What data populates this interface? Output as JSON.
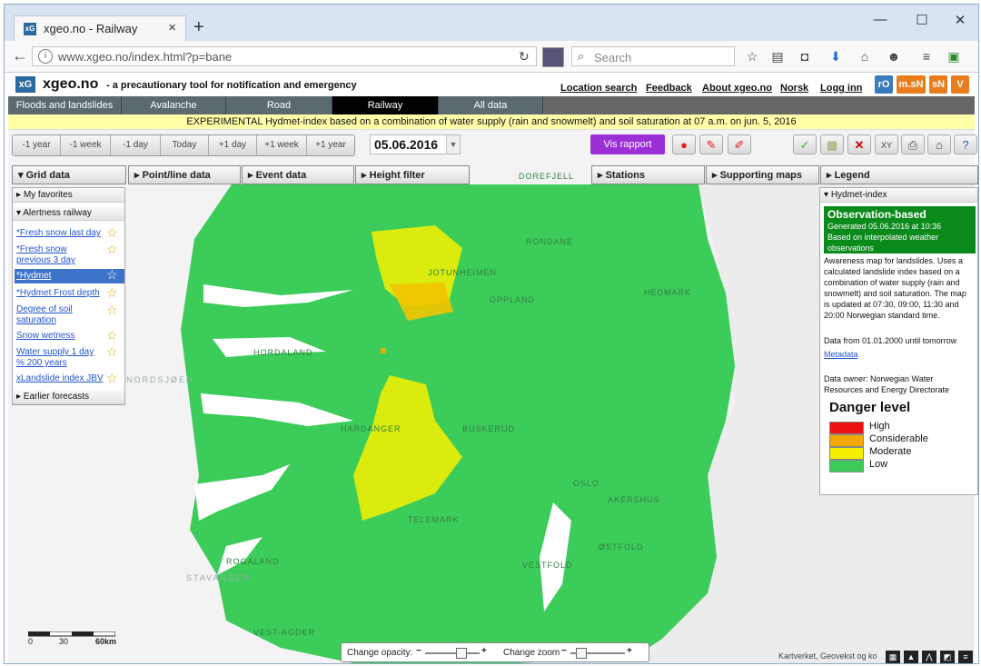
{
  "browser": {
    "tab_title": "xgeo.no - Railway",
    "tab_favicon": "xG",
    "tab_close": "×",
    "new_tab": "+",
    "url": "www.xgeo.no/index.html?p=bane",
    "search_placeholder": "Search",
    "window_controls": [
      "—",
      "☐",
      "✕"
    ],
    "toolbar_icons": [
      "star-icon",
      "reader-icon",
      "pocket-icon",
      "download-icon",
      "home-icon",
      "smiley-icon",
      "menu-icon",
      "extension-icon"
    ]
  },
  "site": {
    "logo": "xG",
    "name": "xgeo.no",
    "tagline": "- a precautionary tool for notification and emergency",
    "links": [
      "Location search",
      "Feedback",
      "About xgeo.no",
      "Norsk",
      "Logg inn"
    ],
    "badges": [
      {
        "label": "rO",
        "color": "#3a7abf"
      },
      {
        "label": "m.sN",
        "color": "#e87d1e"
      },
      {
        "label": "sN",
        "color": "#e87d1e"
      },
      {
        "label": "V",
        "color": "#e87d1e"
      }
    ]
  },
  "categories": [
    {
      "label": "Floods and landslides",
      "active": false
    },
    {
      "label": "Avalanche",
      "active": false
    },
    {
      "label": "Road",
      "active": false
    },
    {
      "label": "Railway",
      "active": true
    },
    {
      "label": "All data",
      "active": false
    }
  ],
  "banner": "EXPERIMENTAL Hydmet-index based on a combination of water supply (rain and snowmelt) and soil saturation at 07 a.m.  on jun. 5, 2016",
  "time_controls": [
    "-1 year",
    "-1 week",
    "-1 day",
    "Today",
    "+1 day",
    "+1 week",
    "+1 year"
  ],
  "date": "05.06.2016",
  "vis_rapport": "Vis rapport",
  "panel_heads": {
    "grid": "Grid data",
    "point": "Point/line data",
    "event": "Event data",
    "height": "Height filter",
    "stations": "Stations",
    "supporting": "Supporting maps",
    "legend": "Legend"
  },
  "left_panel": {
    "favorites": "My favorites",
    "alertness": "Alertness railway",
    "items": [
      "*Fresh snow last day",
      "*Fresh snow previous 3 day",
      "*Hydmet",
      "*Hydmet Frost depth",
      "Degree of soil saturation",
      "Snow wetness",
      "Water supply 1 day % 200 years",
      "xLandslide index JBV"
    ],
    "earlier": "Earlier forecasts"
  },
  "legend": {
    "head": "Hydmet-index",
    "obs_title": "Observation-based",
    "obs_generated": "Generated 05.06.2016 at 10:36",
    "obs_basis": "Based on interpolated weather observations",
    "description": "Awareness map for landslides. Uses a calculated landslide index based on a combination of water supply (rain and snowmelt) and soil saturation. The map is updated at 07:30, 09:00, 11:30 and 20:00 Norwegian standard time.",
    "data_from": "Data from 01.01.2000 until tomorrow",
    "metadata": "Metadata",
    "owner": "Data owner: Norwegian Water Resources and Energy Directorate",
    "danger_title": "Danger level",
    "levels": [
      {
        "label": "High",
        "color": "#ee1111"
      },
      {
        "label": "Considerable",
        "color": "#f2a800"
      },
      {
        "label": "Moderate",
        "color": "#f6f000"
      },
      {
        "label": "Low",
        "color": "#3ccc5a"
      }
    ]
  },
  "map_labels": [
    "DOREFJELL",
    "RONDANE",
    "OPPLAND",
    "HEDMARK",
    "JOTUNHEIMEN",
    "HARDANGER",
    "BUSKERUD",
    "TELEMARK",
    "VESTFOLD",
    "ØSTFOLD",
    "AKERSHUS",
    "OSLO",
    "ROGALAND",
    "VEST-AGDER",
    "STAVANGER",
    "NORDSJØEN",
    "HORDALAND"
  ],
  "scale_labels": [
    "0",
    "30",
    "60km"
  ],
  "bottom": {
    "opacity_label": "Change opacity:",
    "zoom_label": "Change zoom",
    "attribution": "Kartverket, Geovekst og ko"
  }
}
